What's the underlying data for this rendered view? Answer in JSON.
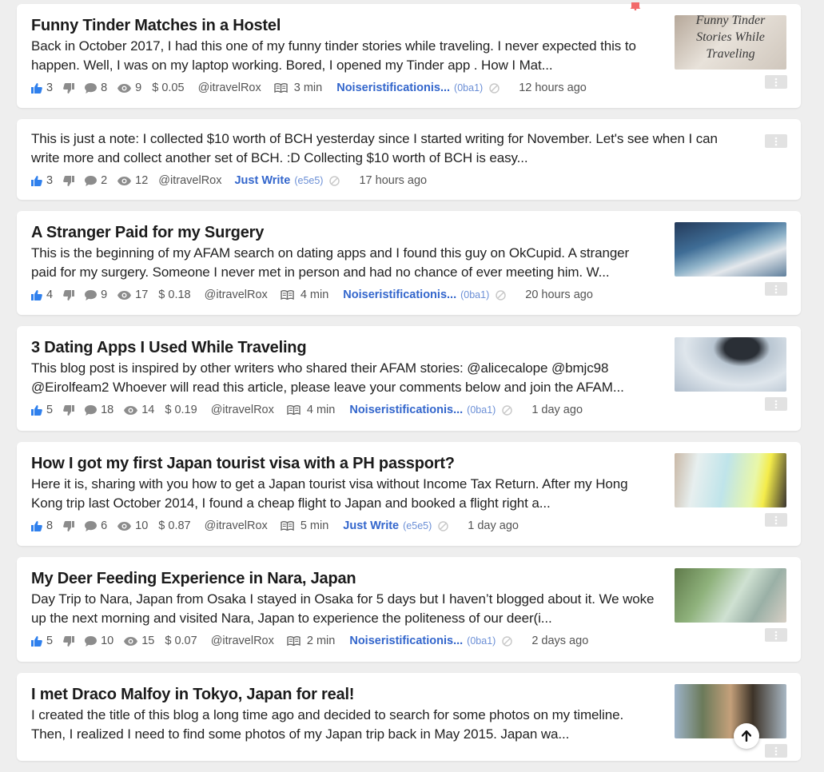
{
  "colors": {
    "accent": "#3366cc",
    "like": "#2f80ed",
    "background": "#eeeeee"
  },
  "icons": {
    "like": "thumbs-up-icon",
    "dislike": "thumbs-down-icon",
    "comments": "comment-icon",
    "views": "eye-icon",
    "read_time": "book-icon",
    "ban": "ban-icon",
    "more": "more-vertical-icon",
    "scroll_top": "arrow-up-icon",
    "notification": "bell-icon"
  },
  "posts": [
    {
      "title": "Funny Tinder Matches in a Hostel",
      "excerpt_lines": [
        "Back in October 2017, I had this one of my funny tinder stories while traveling. I never expected this to",
        "happen. Well, I was on my laptop working. Bored, I opened my  Tinder app . How I Mat..."
      ],
      "likes": "3",
      "comments": "8",
      "views": "9",
      "amount": "$ 0.05",
      "author": "@itravelRox",
      "read_time": "3 min",
      "community": "Noiseristificationis...",
      "community_code": "(0ba1)",
      "time": "12 hours ago",
      "thumb_text": [
        "Funny Tinder",
        "Stories While",
        "Traveling"
      ]
    },
    {
      "title": "",
      "excerpt_lines": [
        "This is just a note: I collected $10 worth of BCH yesterday since I started writing for November. Let's see when I can",
        "write more and collect another set of BCH. :D Collecting $10 worth of BCH is easy..."
      ],
      "likes": "3",
      "comments": "2",
      "views": "12",
      "amount": "",
      "author": "@itravelRox",
      "read_time": "",
      "community": "Just Write",
      "community_code": "(e5e5)",
      "time": "17 hours ago"
    },
    {
      "title": "A Stranger Paid for my Surgery",
      "excerpt_lines": [
        "This is the beginning of my AFAM search on dating apps and I found this guy on OkCupid. A stranger",
        "paid for my surgery. Someone I never met in person and had no chance of ever meeting him. W..."
      ],
      "likes": "4",
      "comments": "9",
      "views": "17",
      "amount": "$ 0.18",
      "author": "@itravelRox",
      "read_time": "4 min",
      "community": "Noiseristificationis...",
      "community_code": "(0ba1)",
      "time": "20 hours ago"
    },
    {
      "title": "3 Dating Apps I Used While Traveling",
      "excerpt_lines": [
        "This blog post is inspired by other writers who shared their AFAM stories: @alicecalope @bmjc98",
        "@Eirolfeam2 Whoever will read this article, please leave your comments below and join the AFAM..."
      ],
      "likes": "5",
      "comments": "18",
      "views": "14",
      "amount": "$ 0.19",
      "author": "@itravelRox",
      "read_time": "4 min",
      "community": "Noiseristificationis...",
      "community_code": "(0ba1)",
      "time": "1 day ago"
    },
    {
      "title": "How I got my first Japan tourist visa with a PH passport?",
      "excerpt_lines": [
        "Here it is, sharing with you how to get a Japan tourist visa without Income Tax Return. After my Hong",
        "Kong trip last October 2014, I found a cheap flight to Japan and booked a flight right a..."
      ],
      "likes": "8",
      "comments": "6",
      "views": "10",
      "amount": "$ 0.87",
      "author": "@itravelRox",
      "read_time": "5 min",
      "community": "Just Write",
      "community_code": "(e5e5)",
      "time": "1 day ago"
    },
    {
      "title": "My Deer Feeding Experience in Nara, Japan",
      "excerpt_lines": [
        "Day Trip to Nara, Japan from Osaka I stayed in Osaka for 5 days but I haven’t blogged about it. We woke",
        "up the next morning and visited Nara, Japan to experience the politeness of our deer(i..."
      ],
      "likes": "5",
      "comments": "10",
      "views": "15",
      "amount": "$ 0.07",
      "author": "@itravelRox",
      "read_time": "2 min",
      "community": "Noiseristificationis...",
      "community_code": "(0ba1)",
      "time": "2 days ago"
    },
    {
      "title": "I met Draco Malfoy in Tokyo, Japan for real!",
      "excerpt_lines": [
        "I created the title of this blog a long time ago and decided to search for some photos on my timeline.",
        "Then, I realized I need to find some photos of my Japan trip back in May 2015. Japan wa..."
      ]
    }
  ]
}
